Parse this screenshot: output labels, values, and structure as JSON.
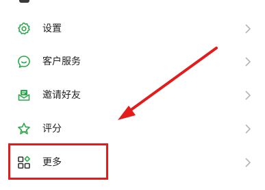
{
  "menu": {
    "items": [
      {
        "label": "设置",
        "icon": "gear-icon"
      },
      {
        "label": "客户服务",
        "icon": "chat-bubble-icon"
      },
      {
        "label": "邀请好友",
        "icon": "invite-envelope-icon"
      },
      {
        "label": "评分",
        "icon": "star-icon"
      },
      {
        "label": "更多",
        "icon": "grid-more-icon"
      }
    ]
  },
  "colors": {
    "icon_green": "#2aa84a",
    "annotation_red": "#e41b1b",
    "chevron_gray": "#b5b5b5"
  }
}
